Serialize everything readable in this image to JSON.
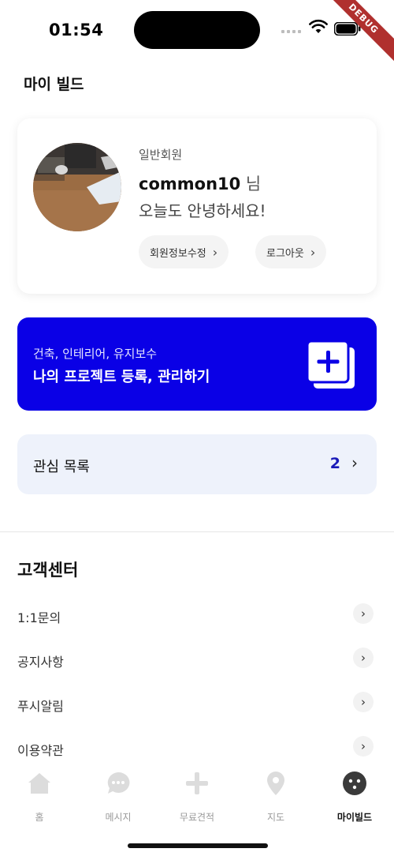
{
  "status_bar": {
    "time": "01:54",
    "debug_label": "DEBUG"
  },
  "page": {
    "title": "마이 빌드"
  },
  "profile": {
    "member_type": "일반회원",
    "username": "common10",
    "suffix": " 님",
    "greeting": "오늘도 안녕하세요!",
    "edit_button": "회원정보수정",
    "logout_button": "로그아웃"
  },
  "project_banner": {
    "subtitle": "건축, 인테리어, 유지보수",
    "title": "나의 프로젝트 등록, 관리하기",
    "icon": "add-project-icon",
    "background_color": "#0a00e6"
  },
  "favorites": {
    "label": "관심 목록",
    "count": "2"
  },
  "customer_center": {
    "title": "고객센터",
    "items": [
      {
        "label": "1:1문의"
      },
      {
        "label": "공지사항"
      },
      {
        "label": "푸시알림"
      },
      {
        "label": "이용약관"
      }
    ]
  },
  "bottom_nav": {
    "items": [
      {
        "label": "홈",
        "icon": "home-icon"
      },
      {
        "label": "메시지",
        "icon": "chat-icon"
      },
      {
        "label": "무료견적",
        "icon": "plus-icon"
      },
      {
        "label": "지도",
        "icon": "map-pin-icon"
      },
      {
        "label": "마이빌드",
        "icon": "my-build-icon",
        "active": true
      }
    ]
  }
}
